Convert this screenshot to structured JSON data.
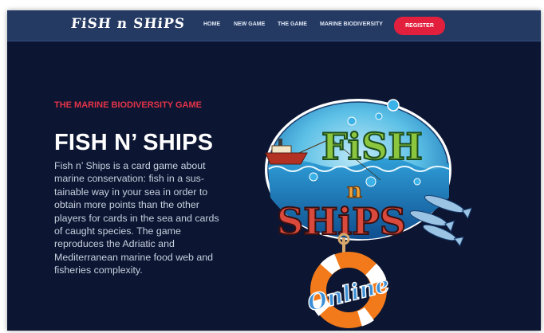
{
  "navbar": {
    "logo_text": "FiSH n SHiPS",
    "links": [
      {
        "label": "HOME"
      },
      {
        "label": "NEW GAME"
      },
      {
        "label": "THE GAME"
      },
      {
        "label": "MARINE BIODIVERSITY"
      }
    ],
    "register_label": "REGISTER"
  },
  "hero": {
    "eyebrow": "THE MARINE BIODIVERSITY GAME",
    "title": "FISH N’ SHIPS",
    "description": "Fish n’ Ships is a card game about marine conservation: fish in a sus-tainable way in your sea in order to obtain more points than the other players for cards in the sea and cards of caught species. The game reproduces the Adriatic and Mediterranean marine food web and fisheries complexity.",
    "art": {
      "logo_word_top": "FiSH",
      "logo_word_mid": "n",
      "logo_word_bottom": "SHiPS",
      "badge_word": "Online"
    }
  },
  "colors": {
    "page_background": "#0c1633",
    "navbar_background": "#243a63",
    "accent_red": "#e2203d",
    "eyebrow_red": "#e53348"
  }
}
